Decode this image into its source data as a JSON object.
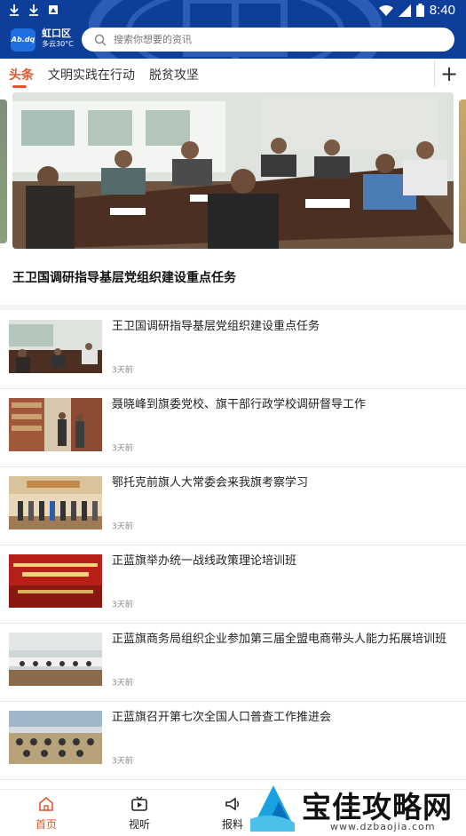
{
  "status_bar": {
    "time": "8:40"
  },
  "header": {
    "logo_text": "Ab.dq",
    "location": {
      "city": "虹口区",
      "weather": "多云30°C"
    },
    "search": {
      "placeholder": "搜索你想要的资讯"
    }
  },
  "tabs": [
    {
      "label": "头条",
      "active": true
    },
    {
      "label": "文明实践在行动",
      "active": false
    },
    {
      "label": "脱贫攻坚",
      "active": false
    }
  ],
  "add_tab_label": "+",
  "carousel": {
    "headline": "王卫国调研指导基层党组织建设重点任务"
  },
  "news": [
    {
      "title": "王卫国调研指导基层党组织建设重点任务",
      "time": "3天前"
    },
    {
      "title": "聂晓峰到旗委党校、旗干部行政学校调研督导工作",
      "time": "3天前"
    },
    {
      "title": "鄂托克前旗人大常委会来我旗考察学习",
      "time": "3天前"
    },
    {
      "title": "正蓝旗举办统一战线政策理论培训班",
      "time": "3天前"
    },
    {
      "title": "正蓝旗商务局组织企业参加第三届全盟电商带头人能力拓展培训班",
      "time": "3天前"
    },
    {
      "title": "正蓝旗召开第七次全国人口普查工作推进会",
      "time": "3天前"
    }
  ],
  "bottom_nav": [
    {
      "label": "首页",
      "icon": "home-icon",
      "active": true
    },
    {
      "label": "视听",
      "icon": "video-icon",
      "active": false
    },
    {
      "label": "报料",
      "icon": "megaphone-icon",
      "active": false
    }
  ],
  "watermark": {
    "text": "宝佳攻略网",
    "url": "www.dzbaojia.com"
  },
  "colors": {
    "header_blue": "#0d3f9a",
    "accent": "#e8542a"
  }
}
